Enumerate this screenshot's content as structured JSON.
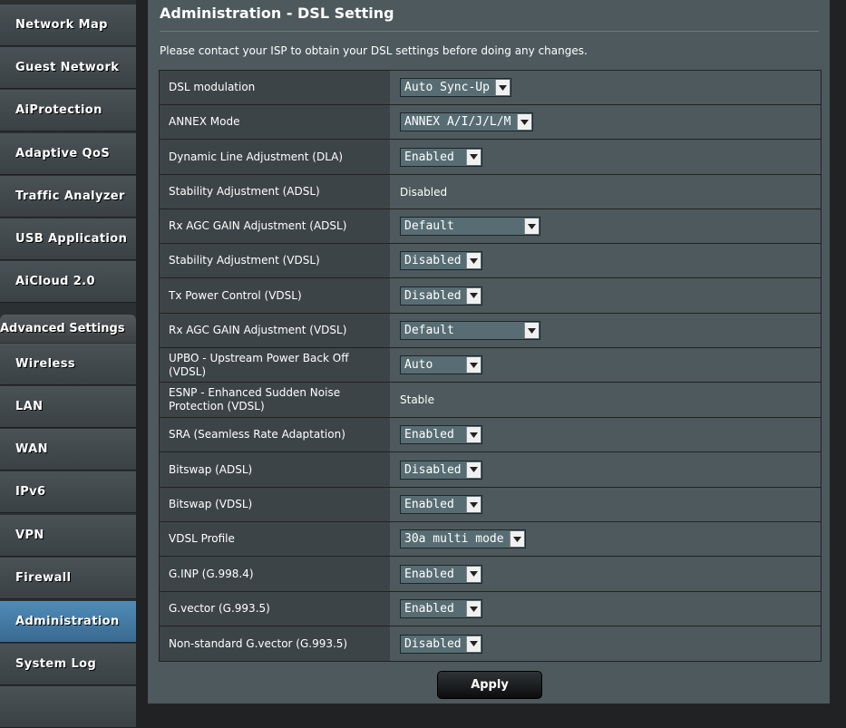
{
  "sidebar": {
    "items": [
      {
        "label": "Network Map",
        "name": "sidebar-item-network-map",
        "active": false
      },
      {
        "label": "Guest Network",
        "name": "sidebar-item-guest-network",
        "active": false
      },
      {
        "label": "AiProtection",
        "name": "sidebar-item-aiprotection",
        "active": false
      },
      {
        "label": "Adaptive QoS",
        "name": "sidebar-item-adaptive-qos",
        "active": false
      },
      {
        "label": "Traffic Analyzer",
        "name": "sidebar-item-traffic-analyzer",
        "active": false
      },
      {
        "label": "USB Application",
        "name": "sidebar-item-usb-application",
        "active": false
      },
      {
        "label": "AiCloud 2.0",
        "name": "sidebar-item-aicloud",
        "active": false
      }
    ],
    "advanced_header": "Advanced Settings",
    "advanced_items": [
      {
        "label": "Wireless",
        "name": "sidebar-item-wireless",
        "active": false
      },
      {
        "label": "LAN",
        "name": "sidebar-item-lan",
        "active": false
      },
      {
        "label": "WAN",
        "name": "sidebar-item-wan",
        "active": false
      },
      {
        "label": "IPv6",
        "name": "sidebar-item-ipv6",
        "active": false
      },
      {
        "label": "VPN",
        "name": "sidebar-item-vpn",
        "active": false
      },
      {
        "label": "Firewall",
        "name": "sidebar-item-firewall",
        "active": false
      },
      {
        "label": "Administration",
        "name": "sidebar-item-administration",
        "active": true
      },
      {
        "label": "System Log",
        "name": "sidebar-item-system-log",
        "active": false
      }
    ]
  },
  "main": {
    "title": "Administration - DSL Setting",
    "notice": "Please contact your ISP to obtain your DSL settings before doing any changes.",
    "apply_label": "Apply"
  },
  "settings": [
    {
      "label": "DSL modulation",
      "type": "select",
      "value": "Auto Sync-Up",
      "name": "dsl-modulation-select"
    },
    {
      "label": "ANNEX Mode",
      "type": "select",
      "value": "ANNEX A/I/J/L/M",
      "name": "annex-mode-select"
    },
    {
      "label": "Dynamic Line Adjustment (DLA)",
      "type": "select",
      "value": "Enabled",
      "name": "dla-select"
    },
    {
      "label": "Stability Adjustment (ADSL)",
      "type": "text",
      "value": "Disabled",
      "name": "stability-adsl-value"
    },
    {
      "label": "Rx AGC GAIN Adjustment (ADSL)",
      "type": "select",
      "value": "Default",
      "name": "rx-agc-adsl-select"
    },
    {
      "label": "Stability Adjustment (VDSL)",
      "type": "select",
      "value": "Disabled",
      "name": "stability-vdsl-select"
    },
    {
      "label": "Tx Power Control (VDSL)",
      "type": "select",
      "value": "Disabled",
      "name": "tx-power-vdsl-select"
    },
    {
      "label": "Rx AGC GAIN Adjustment (VDSL)",
      "type": "select",
      "value": "Default",
      "name": "rx-agc-vdsl-select"
    },
    {
      "label": "UPBO - Upstream Power Back Off (VDSL)",
      "type": "select",
      "value": "Auto",
      "name": "upbo-select"
    },
    {
      "label": "ESNP - Enhanced Sudden Noise Protection (VDSL)",
      "type": "text",
      "value": "Stable",
      "name": "esnp-value"
    },
    {
      "label": "SRA (Seamless Rate Adaptation)",
      "type": "select",
      "value": "Enabled",
      "name": "sra-select"
    },
    {
      "label": "Bitswap (ADSL)",
      "type": "select",
      "value": "Disabled",
      "name": "bitswap-adsl-select"
    },
    {
      "label": "Bitswap (VDSL)",
      "type": "select",
      "value": "Enabled",
      "name": "bitswap-vdsl-select"
    },
    {
      "label": "VDSL Profile",
      "type": "select",
      "value": "30a multi mode",
      "name": "vdsl-profile-select"
    },
    {
      "label": "G.INP (G.998.4)",
      "type": "select",
      "value": "Enabled",
      "name": "ginp-select"
    },
    {
      "label": "G.vector (G.993.5)",
      "type": "select",
      "value": "Enabled",
      "name": "gvector-select"
    },
    {
      "label": "Non-standard G.vector (G.993.5)",
      "type": "select",
      "value": "Disabled",
      "name": "nonstandard-gvector-select"
    }
  ],
  "colors": {
    "accent": "#4f8cb8",
    "panel": "#4d595d",
    "label_cell": "#3d4448"
  }
}
